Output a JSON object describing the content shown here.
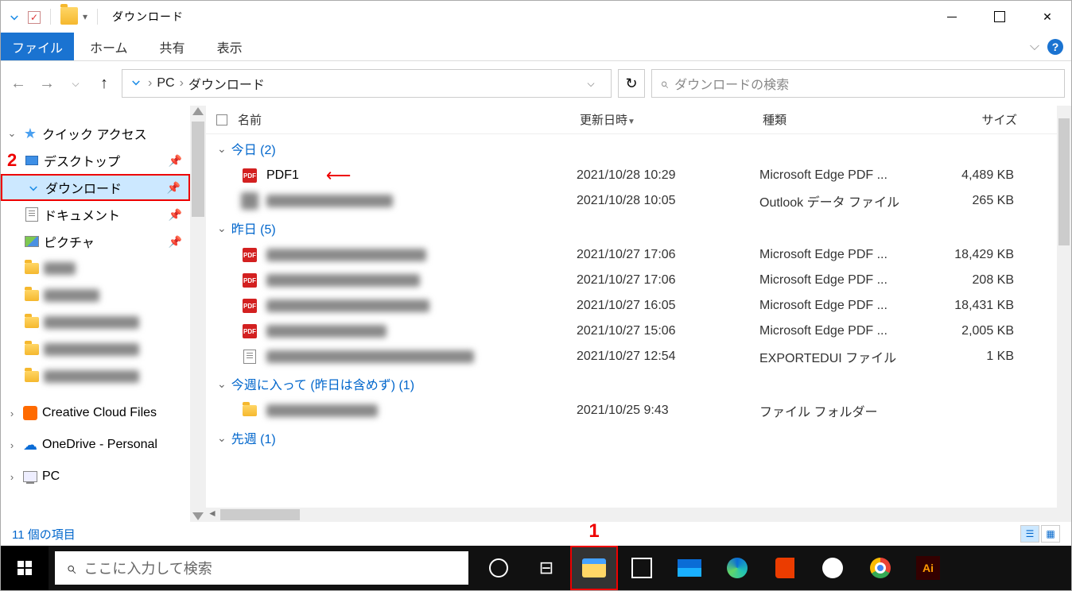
{
  "titlebar": {
    "title": "ダウンロード"
  },
  "ribbon": {
    "file": "ファイル",
    "tabs": [
      "ホーム",
      "共有",
      "表示"
    ]
  },
  "address": {
    "root": "PC",
    "folder": "ダウンロード",
    "search_placeholder": "ダウンロードの検索"
  },
  "nav": {
    "quick_access": {
      "label": "クイック アクセス",
      "annotation": "2"
    },
    "items": [
      {
        "label": "デスクトップ",
        "kind": "desktop",
        "pinned": true,
        "selected": false,
        "outlined": false
      },
      {
        "label": "ダウンロード",
        "kind": "download",
        "pinned": true,
        "selected": true,
        "outlined": true
      },
      {
        "label": "ドキュメント",
        "kind": "document",
        "pinned": true,
        "selected": false,
        "outlined": false
      },
      {
        "label": "ピクチャ",
        "kind": "picture",
        "pinned": true,
        "selected": false,
        "outlined": false
      }
    ],
    "redacted_folders_count": 5,
    "extra": [
      {
        "label": "Creative Cloud Files",
        "kind": "cc"
      },
      {
        "label": "OneDrive - Personal",
        "kind": "onedrive"
      },
      {
        "label": "PC",
        "kind": "pc"
      }
    ]
  },
  "columns": {
    "name": "名前",
    "date": "更新日時",
    "type": "種類",
    "size": "サイズ"
  },
  "groups": [
    {
      "label": "今日 (2)",
      "rows": [
        {
          "icon": "pdf",
          "name": "PDF1",
          "arrow": true,
          "date": "2021/10/28 10:29",
          "type": "Microsoft Edge PDF ...",
          "size": "4,489 KB"
        },
        {
          "icon": "blur",
          "name": "",
          "date": "2021/10/28 10:05",
          "type": "Outlook データ ファイル",
          "size": "265 KB",
          "redacted": true
        }
      ]
    },
    {
      "label": "昨日 (5)",
      "rows": [
        {
          "icon": "pdf",
          "redacted": true,
          "date": "2021/10/27 17:06",
          "type": "Microsoft Edge PDF ...",
          "size": "18,429 KB"
        },
        {
          "icon": "pdf",
          "redacted": true,
          "date": "2021/10/27 17:06",
          "type": "Microsoft Edge PDF ...",
          "size": "208 KB"
        },
        {
          "icon": "pdf",
          "redacted": true,
          "date": "2021/10/27 16:05",
          "type": "Microsoft Edge PDF ...",
          "size": "18,431 KB"
        },
        {
          "icon": "pdf",
          "redacted": true,
          "date": "2021/10/27 15:06",
          "type": "Microsoft Edge PDF ...",
          "size": "2,005 KB"
        },
        {
          "icon": "doc",
          "redacted": true,
          "date": "2021/10/27 12:54",
          "type": "EXPORTEDUI ファイル",
          "size": "1 KB"
        }
      ]
    },
    {
      "label": "今週に入って (昨日は含めず) (1)",
      "rows": [
        {
          "icon": "folder",
          "redacted": true,
          "date": "2021/10/25 9:43",
          "type": "ファイル フォルダー",
          "size": ""
        }
      ]
    },
    {
      "label": "先週 (1)",
      "rows": []
    }
  ],
  "status": {
    "item_count": "11 個の項目"
  },
  "taskbar": {
    "search_placeholder": "ここに入力して検索",
    "annotation": "1",
    "ai_label": "Ai"
  }
}
